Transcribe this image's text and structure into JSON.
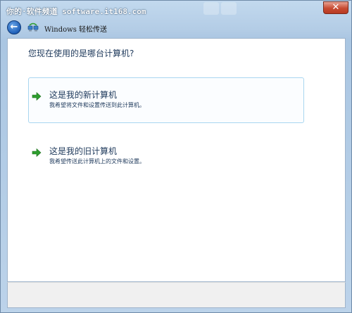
{
  "titlebar": {
    "watermark": "你的·软件频道 software.it168.com",
    "close_glyph": "✕"
  },
  "navbar": {
    "back_glyph": "←",
    "title": "Windows 轻松传送"
  },
  "content": {
    "question": "您现在使用的是哪台计算机?",
    "options": [
      {
        "title": "这是我的新计算机",
        "description": "我希望将文件和设置传送到此计算机。"
      },
      {
        "title": "这是我的旧计算机",
        "description": "我希望传送此计算机上的文件和设置。"
      }
    ]
  },
  "colors": {
    "accent_text": "#1e395b",
    "arrow_green": "#2e9e2e",
    "focus_border": "#a9d6f0"
  }
}
